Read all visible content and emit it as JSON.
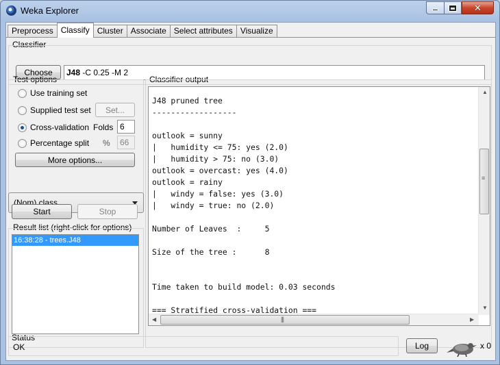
{
  "window": {
    "title": "Weka Explorer"
  },
  "tabs": [
    {
      "label": "Preprocess"
    },
    {
      "label": "Classify",
      "active": true
    },
    {
      "label": "Cluster"
    },
    {
      "label": "Associate"
    },
    {
      "label": "Select attributes"
    },
    {
      "label": "Visualize"
    }
  ],
  "classifier": {
    "group_label": "Classifier",
    "choose_label": "Choose",
    "name": "J48",
    "options": " -C 0.25 -M 2"
  },
  "test_options": {
    "group_label": "Test options",
    "use_training_set": "Use training set",
    "supplied_test_set": "Supplied test set",
    "set_label": "Set...",
    "cross_validation": "Cross-validation",
    "folds_label": "Folds",
    "folds_value": "6",
    "percentage_split": "Percentage split",
    "percent_sign": "%",
    "percentage_value": "66",
    "more_options": "More options...",
    "selected": "cross_validation"
  },
  "class_selector": {
    "value": "(Nom) class"
  },
  "actions": {
    "start": "Start",
    "stop": "Stop"
  },
  "result_list": {
    "label": "Result list (right-click for options)",
    "items": [
      "16:38:28 - trees.J48"
    ]
  },
  "output": {
    "label": "Classifier output",
    "lines": [
      "J48 pruned tree",
      "------------------",
      "",
      "outlook = sunny",
      "|   humidity <= 75: yes (2.0)",
      "|   humidity > 75: no (3.0)",
      "outlook = overcast: yes (4.0)",
      "outlook = rainy",
      "|   windy = false: yes (3.0)",
      "|   windy = true: no (2.0)",
      "",
      "Number of Leaves  :     5",
      "",
      "Size of the tree :      8",
      "",
      "",
      "Time taken to build model: 0.03 seconds",
      "",
      "=== Stratified cross-validation ==="
    ]
  },
  "status": {
    "label": "Status",
    "text": "OK",
    "log_label": "Log",
    "task_count": "x 0"
  },
  "colors": {
    "selection": "#3399ff",
    "close_button": "#c8452b"
  }
}
